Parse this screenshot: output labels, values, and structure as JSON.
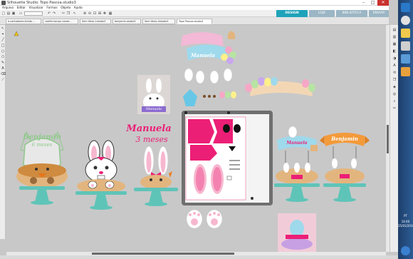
{
  "window": {
    "title": "Silhouette Studio: Topo Pascoa.studio3"
  },
  "menu": [
    "Arquivo",
    "Editar",
    "Visualizar",
    "Formas",
    "Objeto",
    "Ajuda"
  ],
  "modes": {
    "design": "DESIGN",
    "store": "LOJA",
    "library": "BIBLIOTECA",
    "send": "ENVIAR"
  },
  "tabs": [
    "e-cantadores-Arnldo ...",
    "coelho banqu conde...",
    "Sem título-1studio3",
    "benjamin.studio3",
    "Sem título-4studio3",
    "Topo Pascoa.studio3"
  ],
  "canvas": {
    "text_benjamin": "Benjamin",
    "text_benjamin_sub": "6 meses",
    "text_manuela": "Manuela",
    "text_manuela_sub": "3 meses",
    "text_manuela_small": "Manuela",
    "text_benjamin_small": "Benjamin",
    "photo_caption": "Manuela"
  },
  "taskbar": {
    "lang": "PT",
    "time": "14:40",
    "date": "25/01/2016"
  },
  "colors": {
    "accent": "#1fa3ba",
    "pink": "#ec1f76",
    "teal": "#5fc4b8",
    "pancake": "#d9a46b"
  }
}
